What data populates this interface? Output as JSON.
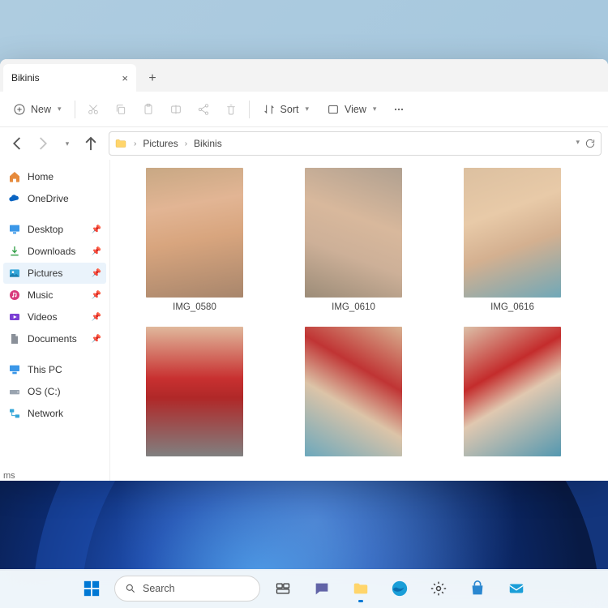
{
  "window": {
    "tab_title": "Bikinis",
    "toolbar": {
      "new": "New",
      "sort": "Sort",
      "view": "View"
    },
    "breadcrumb": {
      "segments": [
        "Pictures",
        "Bikinis"
      ]
    }
  },
  "sidebar": {
    "home": "Home",
    "onedrive": "OneDrive",
    "quick": {
      "desktop": "Desktop",
      "downloads": "Downloads",
      "pictures": "Pictures",
      "music": "Music",
      "videos": "Videos",
      "documents": "Documents"
    },
    "locations": {
      "this_pc": "This PC",
      "os_c": "OS (C:)",
      "network": "Network"
    }
  },
  "files": [
    {
      "name": "IMG_0580"
    },
    {
      "name": "IMG_0610"
    },
    {
      "name": "IMG_0616"
    },
    {
      "name": ""
    },
    {
      "name": ""
    },
    {
      "name": ""
    }
  ],
  "status_footer": "ms",
  "taskbar": {
    "search_placeholder": "Search"
  }
}
